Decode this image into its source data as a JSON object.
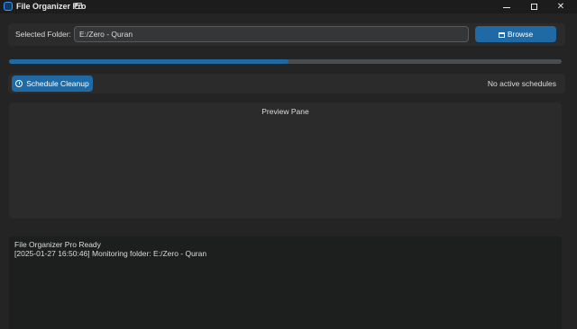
{
  "window": {
    "title": "File Organizer Pro"
  },
  "folder": {
    "label": "Selected Folder:",
    "value": "E:/Zero - Quran",
    "browse_label": "Browse"
  },
  "progress": {
    "fraction": 0.505
  },
  "schedule": {
    "button_label": "Schedule Cleanup",
    "status": "No active schedules"
  },
  "preview": {
    "title": "Preview Pane"
  },
  "log": {
    "lines": [
      "File Organizer Pro Ready",
      "[2025-01-27 16:50:46] Monitoring folder: E:/Zero - Quran"
    ]
  },
  "colors": {
    "accent": "#1f6aa5",
    "background": "#242424",
    "frame": "#2b2b2b",
    "log_background": "#1d1e1e"
  },
  "icons": {
    "app": "app-icon",
    "title_extra": "window-icon",
    "browse": "folder-icon",
    "schedule": "alarm-clock-icon",
    "minimize": "minimize-icon",
    "maximize": "maximize-icon",
    "close": "close-icon"
  }
}
